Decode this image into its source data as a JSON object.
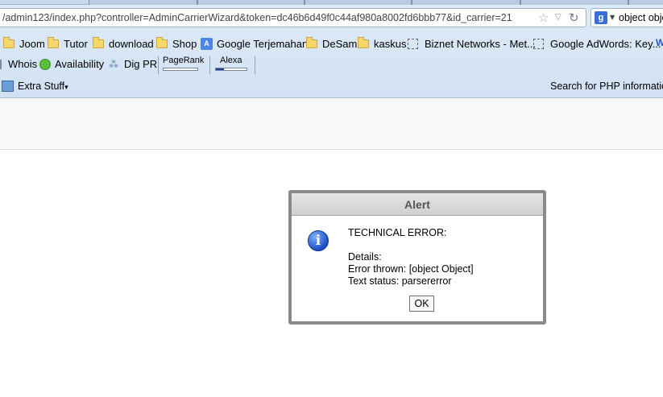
{
  "browser": {
    "url": "/admin123/index.php?controller=AdminCarrierWizard&token=dc46b6d49f0c44af980a8002fd6bbb77&id_carrier=21",
    "search_engine_letter": "g",
    "search_text": "object obje",
    "icons": {
      "bookmark_star": "star-icon",
      "dropdown": "chevron-down-icon",
      "reload": "reload-icon"
    }
  },
  "bookmarks": [
    {
      "label": "Joom",
      "icon": "folder-icon"
    },
    {
      "label": "Tutor",
      "icon": "folder-icon"
    },
    {
      "label": "download",
      "icon": "folder-icon"
    },
    {
      "label": "Shop",
      "icon": "folder-icon"
    },
    {
      "label": "Google Terjemahan",
      "icon": "google-translate-icon"
    },
    {
      "label": "DeSam",
      "icon": "folder-icon"
    },
    {
      "label": "kaskus",
      "icon": "folder-icon"
    },
    {
      "label": "Biznet Networks - Met...",
      "icon": "page-icon"
    },
    {
      "label": "Google AdWords: Key...",
      "icon": "page-icon"
    }
  ],
  "seo_toolbar": {
    "whois": "Whois",
    "availability": "Availability",
    "dig_pr": "Dig PR",
    "pagerank": "PageRank",
    "pagerank_fill": 0,
    "alexa": "Alexa",
    "alexa_fill": 0.25
  },
  "extra_toolbar": {
    "extra_stuff": "Extra Stuff",
    "extra_caret": "▾",
    "search_php": "Search for PHP information"
  },
  "alert": {
    "title": "Alert",
    "icon": "info-icon",
    "lines": [
      "TECHNICAL ERROR:",
      "",
      "Details:",
      "Error thrown: [object Object]",
      "Text status: parsererror"
    ],
    "ok_label": "OK"
  }
}
